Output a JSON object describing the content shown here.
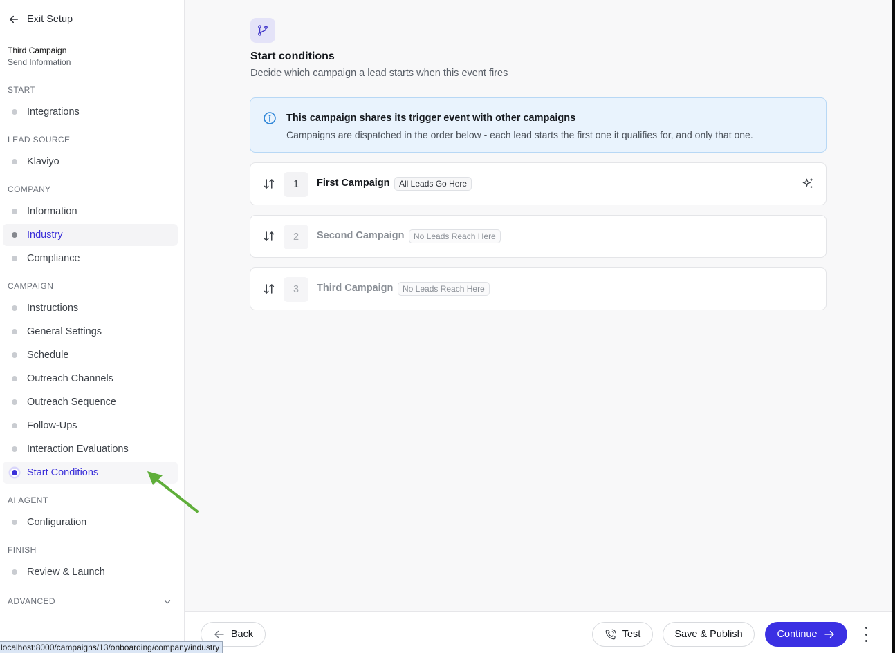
{
  "sidebar": {
    "exit_label": "Exit Setup",
    "campaign_name": "Third Campaign",
    "campaign_subtitle": "Send Information",
    "sections": {
      "start": "START",
      "lead_source": "LEAD SOURCE",
      "company": "COMPANY",
      "campaign": "CAMPAIGN",
      "ai_agent": "AI AGENT",
      "finish": "FINISH",
      "advanced": "ADVANCED"
    },
    "items": {
      "integrations": "Integrations",
      "klaviyo": "Klaviyo",
      "information": "Information",
      "industry": "Industry",
      "compliance": "Compliance",
      "instructions": "Instructions",
      "general_settings": "General Settings",
      "schedule": "Schedule",
      "outreach_channels": "Outreach Channels",
      "outreach_sequence": "Outreach Sequence",
      "follow_ups": "Follow-Ups",
      "interaction_evaluations": "Interaction Evaluations",
      "start_conditions": "Start Conditions",
      "configuration": "Configuration",
      "review_launch": "Review & Launch"
    }
  },
  "main": {
    "title": "Start conditions",
    "subtitle": "Decide which campaign a lead starts when this event fires",
    "alert": {
      "title": "This campaign shares its trigger event with other campaigns",
      "body": "Campaigns are dispatched in the order below - each lead starts the first one it qualifies for, and only that one."
    },
    "campaigns": [
      {
        "order": "1",
        "name": "First Campaign",
        "badge": "All Leads Go Here"
      },
      {
        "order": "2",
        "name": "Second Campaign",
        "badge": "No Leads Reach Here"
      },
      {
        "order": "3",
        "name": "Third Campaign",
        "badge": "No Leads Reach Here"
      }
    ]
  },
  "footer": {
    "back_label": "Back",
    "test_label": "Test",
    "save_publish_label": "Save & Publish",
    "continue_label": "Continue"
  },
  "status_url": "localhost:8000/campaigns/13/onboarding/company/industry",
  "colors": {
    "accent": "#3b30e3",
    "active_nav_text": "#3b30d9",
    "alert_bg": "#e9f3fd",
    "alert_border": "#b8d8f5",
    "annotation_arrow": "#5fae3a"
  }
}
